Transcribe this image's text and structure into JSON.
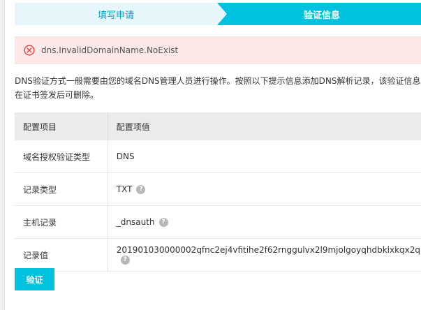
{
  "steps": [
    {
      "label": "填写申请"
    },
    {
      "label": "验证信息"
    }
  ],
  "alert": {
    "message": "dns.InvalidDomainName.NoExist"
  },
  "description": {
    "line1": "DNS验证方式一般需要由您的域名DNS管理人员进行操作。按照以下提示信息添加DNS解析记录，该验证信息",
    "line2": "在证书签发后可删除。"
  },
  "table": {
    "headers": [
      "配置项目",
      "配置项值"
    ],
    "rows": [
      {
        "label": "域名授权验证类型",
        "value": "DNS"
      },
      {
        "label": "记录类型",
        "value": "TXT"
      },
      {
        "label": "主机记录",
        "value": "_dnsauth"
      },
      {
        "label": "记录值",
        "value": "201901030000002qfnc2ej4vfitihe2f62rnggulvx2l9mjolgoyqhdbklxkqx2q"
      }
    ]
  },
  "verify_button": "验证",
  "colors": {
    "accent": "#00c1de",
    "error_bg": "#fde8e8",
    "error_icon": "#e63c3c"
  }
}
